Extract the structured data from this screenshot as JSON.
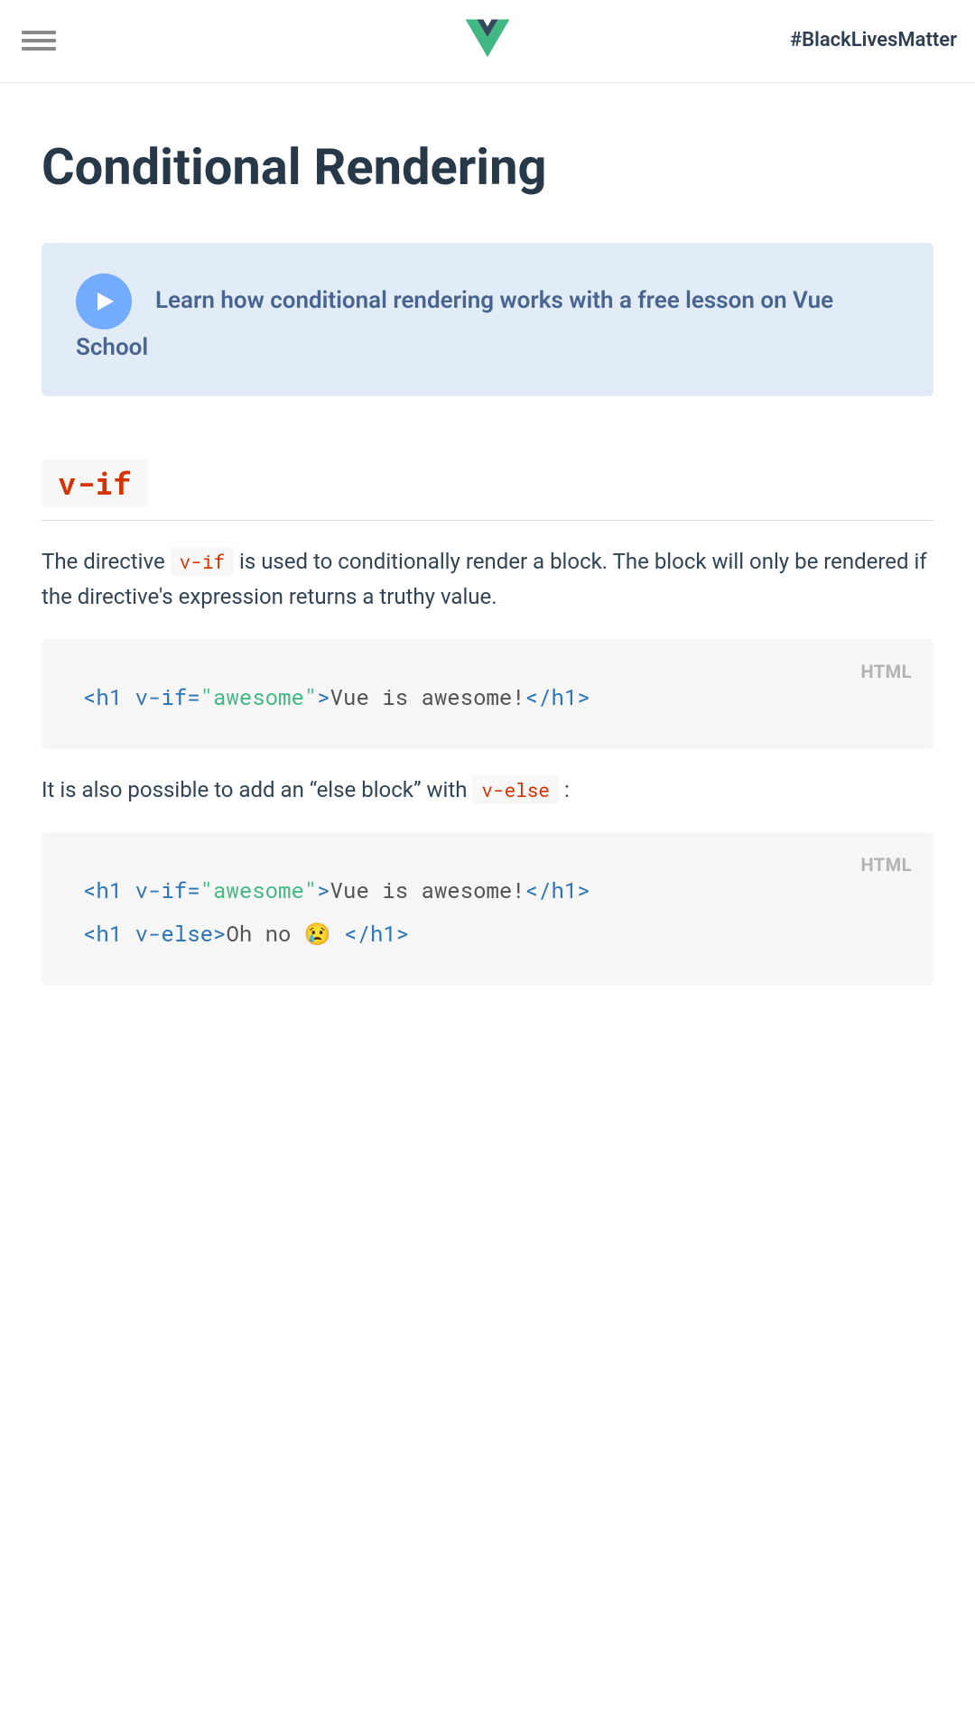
{
  "header": {
    "blm_text": "#BlackLivesMatter"
  },
  "page": {
    "title": "Conditional Rendering"
  },
  "banner": {
    "text": "Learn how conditional rendering works with a free lesson on Vue School"
  },
  "section": {
    "heading_code": "v-if"
  },
  "para1": {
    "pre": "The directive ",
    "code": "v-if",
    "post": " is used to conditionally render a block. The block will only be rendered if the directive's expression returns a truthy value."
  },
  "code1": {
    "lang": "HTML",
    "tokens": {
      "t1": "<h1 ",
      "t2": "v-if=",
      "t3": "\"awesome\"",
      "t4": ">",
      "t5": "Vue is awesome!",
      "t6": "</h1>"
    }
  },
  "para2": {
    "pre": "It is also possible to add an “else block” with ",
    "code": "v-else",
    "post": " :"
  },
  "code2": {
    "lang": "HTML",
    "line1": {
      "t1": "<h1 ",
      "t2": "v-if=",
      "t3": "\"awesome\"",
      "t4": ">",
      "t5": "Vue is awesome!",
      "t6": "</h1>"
    },
    "line2": {
      "t1": "<h1 ",
      "t2": "v-else",
      "t3": ">",
      "t4": "Oh no 😢 ",
      "t5": "</h1>"
    }
  }
}
